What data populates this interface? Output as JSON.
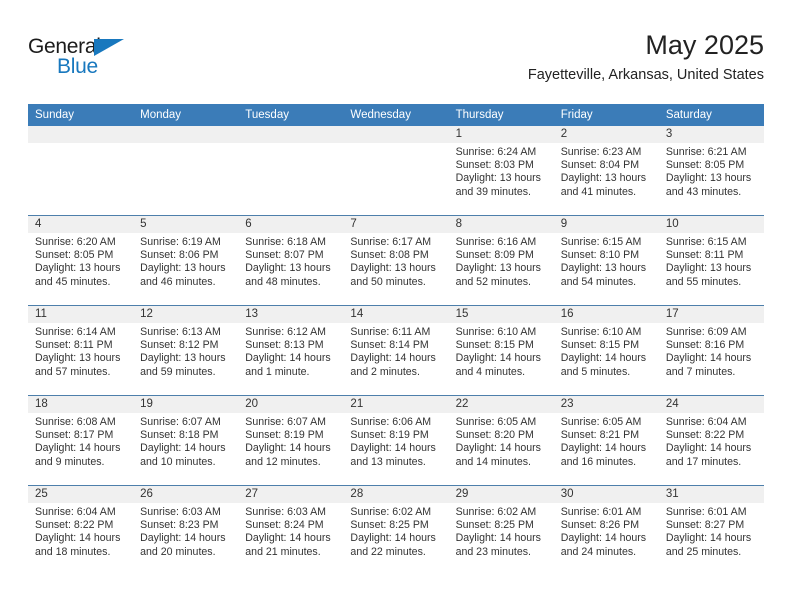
{
  "brand": {
    "logo_top": "General",
    "logo_bottom": "Blue",
    "triangle_icon": "triangle-icon",
    "accent_color": "#1878be"
  },
  "header": {
    "title": "May 2025",
    "subtitle": "Fayetteville, Arkansas, United States"
  },
  "theme": {
    "header_bar_color": "#3b7cb8",
    "day_strip_color": "#f0f0f0",
    "row_divider_color": "#4d7fab",
    "text_color": "#333333"
  },
  "weekdays": [
    "Sunday",
    "Monday",
    "Tuesday",
    "Wednesday",
    "Thursday",
    "Friday",
    "Saturday"
  ],
  "weeks": [
    [
      {
        "day": "",
        "empty": true,
        "lines": []
      },
      {
        "day": "",
        "empty": true,
        "lines": []
      },
      {
        "day": "",
        "empty": true,
        "lines": []
      },
      {
        "day": "",
        "empty": true,
        "lines": []
      },
      {
        "day": "1",
        "empty": false,
        "lines": [
          "Sunrise: 6:24 AM",
          "Sunset: 8:03 PM",
          "Daylight: 13 hours",
          "and 39 minutes."
        ]
      },
      {
        "day": "2",
        "empty": false,
        "lines": [
          "Sunrise: 6:23 AM",
          "Sunset: 8:04 PM",
          "Daylight: 13 hours",
          "and 41 minutes."
        ]
      },
      {
        "day": "3",
        "empty": false,
        "lines": [
          "Sunrise: 6:21 AM",
          "Sunset: 8:05 PM",
          "Daylight: 13 hours",
          "and 43 minutes."
        ]
      }
    ],
    [
      {
        "day": "4",
        "empty": false,
        "lines": [
          "Sunrise: 6:20 AM",
          "Sunset: 8:05 PM",
          "Daylight: 13 hours",
          "and 45 minutes."
        ]
      },
      {
        "day": "5",
        "empty": false,
        "lines": [
          "Sunrise: 6:19 AM",
          "Sunset: 8:06 PM",
          "Daylight: 13 hours",
          "and 46 minutes."
        ]
      },
      {
        "day": "6",
        "empty": false,
        "lines": [
          "Sunrise: 6:18 AM",
          "Sunset: 8:07 PM",
          "Daylight: 13 hours",
          "and 48 minutes."
        ]
      },
      {
        "day": "7",
        "empty": false,
        "lines": [
          "Sunrise: 6:17 AM",
          "Sunset: 8:08 PM",
          "Daylight: 13 hours",
          "and 50 minutes."
        ]
      },
      {
        "day": "8",
        "empty": false,
        "lines": [
          "Sunrise: 6:16 AM",
          "Sunset: 8:09 PM",
          "Daylight: 13 hours",
          "and 52 minutes."
        ]
      },
      {
        "day": "9",
        "empty": false,
        "lines": [
          "Sunrise: 6:15 AM",
          "Sunset: 8:10 PM",
          "Daylight: 13 hours",
          "and 54 minutes."
        ]
      },
      {
        "day": "10",
        "empty": false,
        "lines": [
          "Sunrise: 6:15 AM",
          "Sunset: 8:11 PM",
          "Daylight: 13 hours",
          "and 55 minutes."
        ]
      }
    ],
    [
      {
        "day": "11",
        "empty": false,
        "lines": [
          "Sunrise: 6:14 AM",
          "Sunset: 8:11 PM",
          "Daylight: 13 hours",
          "and 57 minutes."
        ]
      },
      {
        "day": "12",
        "empty": false,
        "lines": [
          "Sunrise: 6:13 AM",
          "Sunset: 8:12 PM",
          "Daylight: 13 hours",
          "and 59 minutes."
        ]
      },
      {
        "day": "13",
        "empty": false,
        "lines": [
          "Sunrise: 6:12 AM",
          "Sunset: 8:13 PM",
          "Daylight: 14 hours",
          "and 1 minute."
        ]
      },
      {
        "day": "14",
        "empty": false,
        "lines": [
          "Sunrise: 6:11 AM",
          "Sunset: 8:14 PM",
          "Daylight: 14 hours",
          "and 2 minutes."
        ]
      },
      {
        "day": "15",
        "empty": false,
        "lines": [
          "Sunrise: 6:10 AM",
          "Sunset: 8:15 PM",
          "Daylight: 14 hours",
          "and 4 minutes."
        ]
      },
      {
        "day": "16",
        "empty": false,
        "lines": [
          "Sunrise: 6:10 AM",
          "Sunset: 8:15 PM",
          "Daylight: 14 hours",
          "and 5 minutes."
        ]
      },
      {
        "day": "17",
        "empty": false,
        "lines": [
          "Sunrise: 6:09 AM",
          "Sunset: 8:16 PM",
          "Daylight: 14 hours",
          "and 7 minutes."
        ]
      }
    ],
    [
      {
        "day": "18",
        "empty": false,
        "lines": [
          "Sunrise: 6:08 AM",
          "Sunset: 8:17 PM",
          "Daylight: 14 hours",
          "and 9 minutes."
        ]
      },
      {
        "day": "19",
        "empty": false,
        "lines": [
          "Sunrise: 6:07 AM",
          "Sunset: 8:18 PM",
          "Daylight: 14 hours",
          "and 10 minutes."
        ]
      },
      {
        "day": "20",
        "empty": false,
        "lines": [
          "Sunrise: 6:07 AM",
          "Sunset: 8:19 PM",
          "Daylight: 14 hours",
          "and 12 minutes."
        ]
      },
      {
        "day": "21",
        "empty": false,
        "lines": [
          "Sunrise: 6:06 AM",
          "Sunset: 8:19 PM",
          "Daylight: 14 hours",
          "and 13 minutes."
        ]
      },
      {
        "day": "22",
        "empty": false,
        "lines": [
          "Sunrise: 6:05 AM",
          "Sunset: 8:20 PM",
          "Daylight: 14 hours",
          "and 14 minutes."
        ]
      },
      {
        "day": "23",
        "empty": false,
        "lines": [
          "Sunrise: 6:05 AM",
          "Sunset: 8:21 PM",
          "Daylight: 14 hours",
          "and 16 minutes."
        ]
      },
      {
        "day": "24",
        "empty": false,
        "lines": [
          "Sunrise: 6:04 AM",
          "Sunset: 8:22 PM",
          "Daylight: 14 hours",
          "and 17 minutes."
        ]
      }
    ],
    [
      {
        "day": "25",
        "empty": false,
        "lines": [
          "Sunrise: 6:04 AM",
          "Sunset: 8:22 PM",
          "Daylight: 14 hours",
          "and 18 minutes."
        ]
      },
      {
        "day": "26",
        "empty": false,
        "lines": [
          "Sunrise: 6:03 AM",
          "Sunset: 8:23 PM",
          "Daylight: 14 hours",
          "and 20 minutes."
        ]
      },
      {
        "day": "27",
        "empty": false,
        "lines": [
          "Sunrise: 6:03 AM",
          "Sunset: 8:24 PM",
          "Daylight: 14 hours",
          "and 21 minutes."
        ]
      },
      {
        "day": "28",
        "empty": false,
        "lines": [
          "Sunrise: 6:02 AM",
          "Sunset: 8:25 PM",
          "Daylight: 14 hours",
          "and 22 minutes."
        ]
      },
      {
        "day": "29",
        "empty": false,
        "lines": [
          "Sunrise: 6:02 AM",
          "Sunset: 8:25 PM",
          "Daylight: 14 hours",
          "and 23 minutes."
        ]
      },
      {
        "day": "30",
        "empty": false,
        "lines": [
          "Sunrise: 6:01 AM",
          "Sunset: 8:26 PM",
          "Daylight: 14 hours",
          "and 24 minutes."
        ]
      },
      {
        "day": "31",
        "empty": false,
        "lines": [
          "Sunrise: 6:01 AM",
          "Sunset: 8:27 PM",
          "Daylight: 14 hours",
          "and 25 minutes."
        ]
      }
    ]
  ]
}
